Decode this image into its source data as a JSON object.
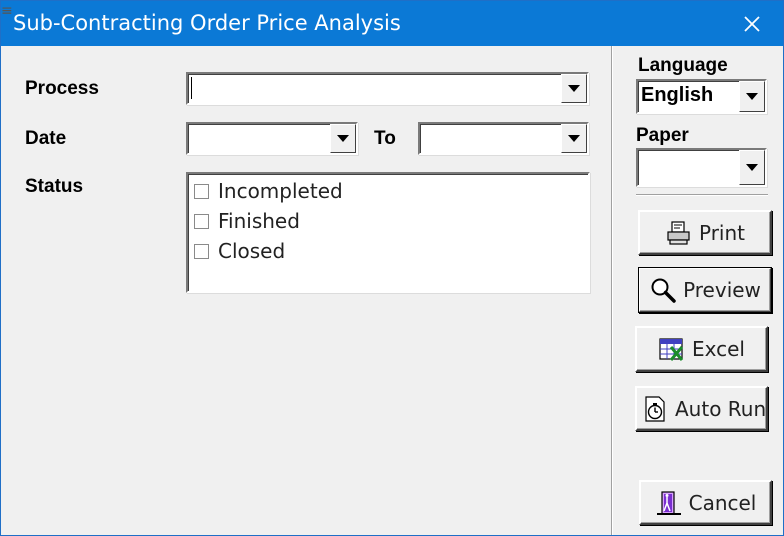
{
  "window": {
    "title": "Sub-Contracting Order Price Analysis",
    "close_glyph": "✕"
  },
  "form": {
    "process_label": "Process",
    "process_value": "",
    "date_label": "Date",
    "date_from_value": "",
    "to_label": "To",
    "date_to_value": "",
    "status_label": "Status",
    "status_options": [
      {
        "label": "Incompleted",
        "checked": false
      },
      {
        "label": "Finished",
        "checked": false
      },
      {
        "label": "Closed",
        "checked": false
      }
    ]
  },
  "sidebar": {
    "language_label": "Language",
    "language_value": "English",
    "paper_label": "Paper",
    "paper_value": "",
    "buttons": {
      "print": "Print",
      "preview": "Preview",
      "excel": "Excel",
      "auto_run": "Auto Run",
      "cancel": "Cancel"
    }
  },
  "icons": {
    "close": "close-icon",
    "print": "printer-icon",
    "preview": "magnifier-icon",
    "excel": "spreadsheet-icon",
    "auto_run": "clock-document-icon",
    "cancel": "exit-door-icon"
  },
  "colors": {
    "titlebar": "#0b79d6",
    "title_text": "#ffffff",
    "dialog_bg": "#f0f0f0"
  }
}
